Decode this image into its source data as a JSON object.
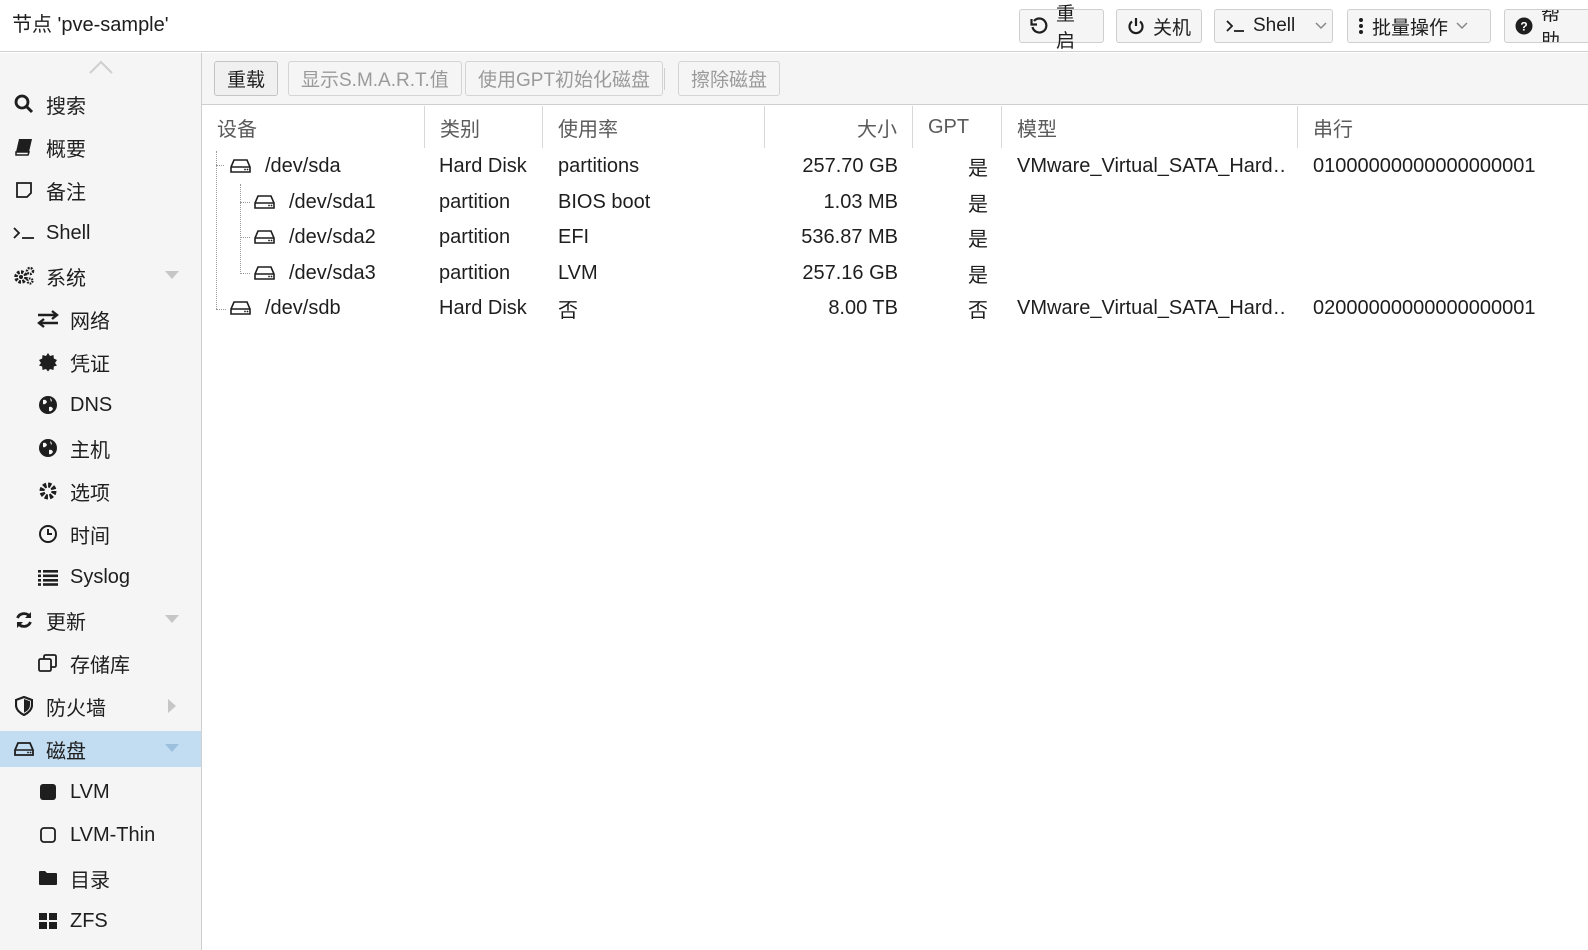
{
  "header": {
    "title": "节点 'pve-sample'",
    "buttons": {
      "reboot": "重启",
      "shutdown": "关机",
      "shell": "Shell",
      "bulk": "批量操作",
      "help": "帮助"
    }
  },
  "sidebar": {
    "items": [
      {
        "label": "搜索",
        "icon": "search-icon"
      },
      {
        "label": "概要",
        "icon": "book-icon"
      },
      {
        "label": "备注",
        "icon": "note-icon"
      },
      {
        "label": "Shell",
        "icon": "terminal-icon"
      },
      {
        "label": "系统",
        "icon": "gears-icon"
      },
      {
        "label": "网络",
        "icon": "exchange-icon"
      },
      {
        "label": "凭证",
        "icon": "certificate-icon"
      },
      {
        "label": "DNS",
        "icon": "globe-icon"
      },
      {
        "label": "主机",
        "icon": "globe-icon"
      },
      {
        "label": "选项",
        "icon": "gear-icon"
      },
      {
        "label": "时间",
        "icon": "clock-icon"
      },
      {
        "label": "Syslog",
        "icon": "list-icon"
      },
      {
        "label": "更新",
        "icon": "refresh-icon"
      },
      {
        "label": "存储库",
        "icon": "files-icon"
      },
      {
        "label": "防火墙",
        "icon": "shield-icon"
      },
      {
        "label": "磁盘",
        "icon": "hdd-icon"
      },
      {
        "label": "LVM",
        "icon": "square-filled-icon"
      },
      {
        "label": "LVM-Thin",
        "icon": "square-outline-icon"
      },
      {
        "label": "目录",
        "icon": "folder-icon"
      },
      {
        "label": "ZFS",
        "icon": "grid-icon"
      }
    ],
    "selected": "磁盘"
  },
  "toolbar": {
    "reload": "重载",
    "smart": "显示S.M.A.R.T.值",
    "gpt_init": "使用GPT初始化磁盘",
    "wipe": "擦除磁盘"
  },
  "grid": {
    "columns": {
      "device": "设备",
      "type": "类别",
      "usage": "使用率",
      "size": "大小",
      "gpt": "GPT",
      "model": "模型",
      "serial": "串行"
    },
    "rows": [
      {
        "device": "/dev/sda",
        "type": "Hard Disk",
        "usage": "partitions",
        "size": "257.70 GB",
        "gpt": "是",
        "model": "VMware_Virtual_SATA_Hard…",
        "serial": "01000000000000000001"
      },
      {
        "device": "/dev/sda1",
        "type": "partition",
        "usage": "BIOS boot",
        "size": "1.03 MB",
        "gpt": "是",
        "model": "",
        "serial": ""
      },
      {
        "device": "/dev/sda2",
        "type": "partition",
        "usage": "EFI",
        "size": "536.87 MB",
        "gpt": "是",
        "model": "",
        "serial": ""
      },
      {
        "device": "/dev/sda3",
        "type": "partition",
        "usage": "LVM",
        "size": "257.16 GB",
        "gpt": "是",
        "model": "",
        "serial": ""
      },
      {
        "device": "/dev/sdb",
        "type": "Hard Disk",
        "usage": "否",
        "size": "8.00 TB",
        "gpt": "否",
        "model": "VMware_Virtual_SATA_Hard…",
        "serial": "02000000000000000001"
      }
    ]
  }
}
